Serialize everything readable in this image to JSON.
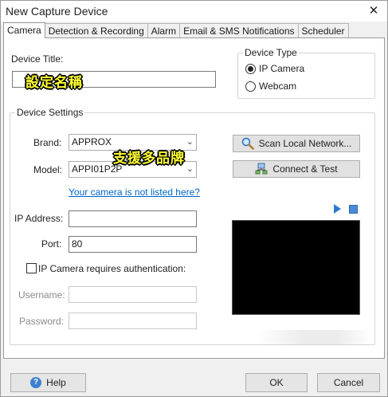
{
  "window": {
    "title": "New Capture Device",
    "close_glyph": "✕"
  },
  "tabs": [
    {
      "label": "Camera",
      "active": true
    },
    {
      "label": "Detection & Recording"
    },
    {
      "label": "Alarm"
    },
    {
      "label": "Email & SMS Notifications"
    },
    {
      "label": "Scheduler"
    }
  ],
  "device_title": {
    "label": "Device Title:",
    "value": ""
  },
  "overlay_captions": {
    "title_hint": "設定名稱",
    "brand_hint": "支援多品牌"
  },
  "device_type": {
    "legend": "Device Type",
    "options": [
      {
        "label": "IP Camera",
        "checked": true
      },
      {
        "label": "Webcam",
        "checked": false
      }
    ]
  },
  "device_settings": {
    "legend": "Device Settings",
    "brand_label": "Brand:",
    "brand_value": "APPROX",
    "model_label": "Model:",
    "model_value": "APPI01P2P",
    "not_listed_link": "Your camera is not listed here?",
    "ip_label": "IP Address:",
    "ip_value": "",
    "port_label": "Port:",
    "port_value": "80",
    "auth_label": "IP Camera requires authentication:",
    "auth_checked": false,
    "username_label": "Username:",
    "username_value": "",
    "password_label": "Password:",
    "password_value": ""
  },
  "actions": {
    "scan_label": "Scan Local Network...",
    "connect_label": "Connect & Test"
  },
  "icons": {
    "scan": "magnifier-icon",
    "connect": "network-icon",
    "play": "play-icon",
    "stop": "stop-icon",
    "help": "help-icon",
    "dropdown": "chevron-down-icon"
  },
  "footer": {
    "help_label": "Help",
    "ok_label": "OK",
    "cancel_label": "Cancel"
  },
  "colors": {
    "link": "#0066cc",
    "overlay_text": "#ffff33",
    "preview_bg": "#000000",
    "accent": "#2e7ad1"
  }
}
